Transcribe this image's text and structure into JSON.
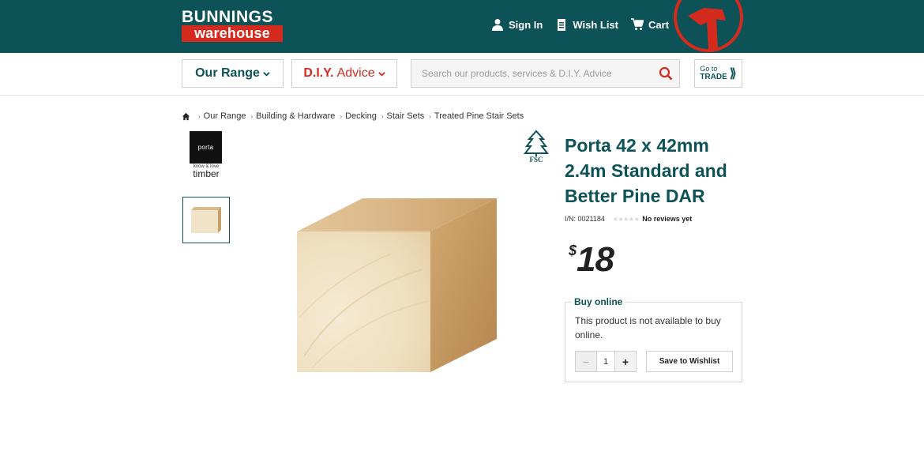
{
  "header": {
    "logo_top": "BUNNINGS",
    "logo_bottom": "warehouse",
    "links": {
      "sign_in": "Sign In",
      "wish_list": "Wish List",
      "cart": "Cart"
    },
    "colors": {
      "brand_teal": "#0d5257",
      "brand_red": "#d52b1e"
    }
  },
  "nav": {
    "our_range": "Our Range",
    "diy_bold": "D.I.Y.",
    "diy_rest": "Advice",
    "search_placeholder": "Search our products, services & D.I.Y. Advice",
    "trade_line1": "Go to",
    "trade_line2": "TRADE",
    "trade_arrow": "⟫"
  },
  "breadcrumb": {
    "items": [
      "Our Range",
      "Building & Hardware",
      "Decking",
      "Stair Sets",
      "Treated Pine Stair Sets"
    ]
  },
  "brand": {
    "name": "porta",
    "tagline": "know & love",
    "word": "timber"
  },
  "product": {
    "title": "Porta 42 x 42mm 2.4m Standard and Better Pine DAR",
    "item_number": "I/N: 0021184",
    "stars": "★★★★★",
    "reviews": "No reviews yet",
    "price_currency": "$",
    "price_amount": "18",
    "certification": "FSC"
  },
  "buy": {
    "legend": "Buy online",
    "message": "This product is not available to buy online.",
    "quantity": "1",
    "minus": "−",
    "plus": "+",
    "wishlist_label": "Save to Wishlist"
  }
}
